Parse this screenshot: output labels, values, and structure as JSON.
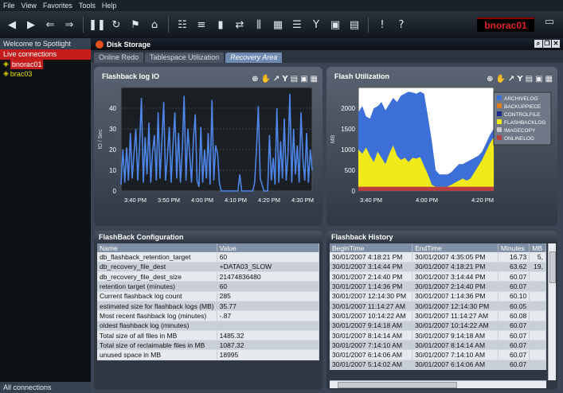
{
  "menu": [
    "File",
    "View",
    "Favorites",
    "Tools",
    "Help"
  ],
  "toolbar": {
    "icons": [
      "back-icon",
      "forward-icon",
      "nav-back-icon",
      "nav-forward-icon",
      "pause-icon",
      "refresh-icon",
      "bookmark-icon",
      "home-icon",
      "sessions-icon",
      "sql-icon",
      "bar-chart-icon",
      "swap-icon",
      "columns-icon",
      "grid-icon",
      "list-icon",
      "filter-icon",
      "export-icon",
      "report-icon",
      "alert-icon",
      "help-icon"
    ],
    "brand": "bnorac01"
  },
  "sidebar": {
    "header": "Welcome to Spotlight",
    "live_label": "Live connections",
    "items": [
      {
        "label": "bnorac01",
        "selected": true
      },
      {
        "label": "brac03",
        "selected": false
      }
    ],
    "footer": "All connections"
  },
  "window": {
    "title": "Disk Storage",
    "tabs": [
      "Online Redo",
      "Tablespace Utilization",
      "Recovery Area"
    ],
    "active_tab": 2
  },
  "charts": [
    {
      "title": "Flashback log IO",
      "chart_data": {
        "type": "line",
        "ylabel": "IO / Sec",
        "ylim": [
          0,
          50
        ],
        "yticks": [
          0,
          10,
          20,
          30,
          40
        ],
        "x_tick_labels": [
          "3:40 PM",
          "3:50 PM",
          "4:00 PM",
          "4:10 PM",
          "4:20 PM",
          "4:30 PM"
        ],
        "series": [
          {
            "color": "#4d86e8",
            "values": [
              3,
              20,
              4,
              21,
              5,
              28,
              6,
              18,
              30,
              5,
              22,
              45,
              4,
              26,
              8,
              33,
              4,
              19,
              27,
              5,
              38,
              6,
              24,
              43,
              5,
              17,
              31,
              4,
              22,
              38,
              6,
              28,
              4,
              20,
              46,
              5,
              30,
              18,
              4,
              25,
              37,
              5,
              2,
              31,
              4,
              20,
              6,
              28,
              3,
              44,
              5,
              22,
              18,
              4,
              0,
              0,
              0,
              0,
              0,
              0,
              0,
              0,
              0,
              0,
              8,
              0,
              0,
              0,
              0,
              0,
              0,
              0,
              4,
              20,
              41,
              6,
              3,
              0,
              0,
              0,
              27,
              5,
              16,
              3,
              40,
              4,
              24,
              6,
              35,
              5,
              18,
              47,
              4,
              30,
              8,
              22,
              4,
              38,
              16,
              5,
              28,
              4,
              20,
              10
            ]
          }
        ]
      }
    },
    {
      "title": "Flash Utilization",
      "chart_data": {
        "type": "area",
        "ylabel": "MB",
        "ylim": [
          0,
          2500
        ],
        "yticks": [
          0,
          500,
          1000,
          1500,
          2000
        ],
        "x_tick_labels": [
          "3:40 PM",
          "4:00 PM",
          "4:20 PM"
        ],
        "legend": [
          "ARCHIVELOG",
          "BACKUPPIECE",
          "CONTROLFILE",
          "FLASHBACKLOG",
          "IMAGECOPY",
          "ONLINELOG"
        ],
        "legend_colors": [
          "#3c6fd8",
          "#e07a1a",
          "#1c2a8a",
          "#f0ea1a",
          "#c8c8c8",
          "#b84040"
        ],
        "series": [
          {
            "name": "ONLINELOG",
            "color": "#b84040",
            "values": [
              100,
              100,
              100,
              100,
              100,
              100,
              100,
              100,
              100,
              100,
              100,
              100,
              100,
              100,
              100,
              100,
              100,
              100,
              100,
              100,
              100,
              100,
              100,
              100,
              100,
              100,
              100,
              100,
              100,
              100,
              100,
              100,
              100,
              100,
              100,
              100
            ]
          },
          {
            "name": "FLASHBACKLOG",
            "color": "#f0ea1a",
            "values": [
              1000,
              900,
              1050,
              850,
              700,
              950,
              800,
              650,
              900,
              1100,
              850,
              750,
              800,
              700,
              800,
              780,
              820,
              600,
              400,
              150,
              100,
              100,
              100,
              100,
              150,
              200,
              250,
              300,
              250,
              300,
              450,
              600,
              750,
              950,
              1150,
              1300
            ]
          },
          {
            "name": "ARCHIVELOG",
            "color": "#3c6fd8",
            "values": [
              1900,
              2050,
              1800,
              1750,
              2000,
              2050,
              2150,
              1950,
              2100,
              2250,
              2150,
              2300,
              2350,
              2400,
              2380,
              2350,
              2400,
              2350,
              1800,
              1200,
              500,
              400,
              400,
              400,
              450,
              550,
              650,
              650,
              700,
              750,
              800,
              850,
              950,
              1150,
              1350,
              1500
            ]
          }
        ]
      }
    }
  ],
  "flashback_config": {
    "title": "FlashBack Configuration",
    "columns": [
      "Name",
      "Value"
    ],
    "rows": [
      [
        "db_flashback_retention_target",
        "60"
      ],
      [
        "db_recovery_file_dest",
        "+DATA03_SLOW"
      ],
      [
        "db_recovery_file_dest_size",
        "21474836480"
      ],
      [
        "retention target (minutes)",
        "60"
      ],
      [
        "Current flashback log count",
        "285"
      ],
      [
        "estimated size for flashback logs (MB)",
        "35.77"
      ],
      [
        "Most recent flashback log (minutes)",
        "-.87"
      ],
      [
        "oldest flashback log (minutes)",
        ""
      ],
      [
        "Total size of all files in MB",
        "1485.32"
      ],
      [
        "Total size of reclaimable files in MB",
        "1087.32"
      ],
      [
        "unused space in MB",
        "18995"
      ]
    ]
  },
  "flashback_history": {
    "title": "Flashback History",
    "columns": [
      "BeginTime",
      "EndTime",
      "Minutes",
      "MB"
    ],
    "rows": [
      [
        "30/01/2007 4:18:21 PM",
        "30/01/2007 4:35:05 PM",
        "16.73",
        "5,"
      ],
      [
        "30/01/2007 3:14:44 PM",
        "30/01/2007 4:18:21 PM",
        "63.62",
        "19,"
      ],
      [
        "30/01/2007 2:14:40 PM",
        "30/01/2007 3:14:44 PM",
        "60.07",
        ""
      ],
      [
        "30/01/2007 1:14:36 PM",
        "30/01/2007 2:14:40 PM",
        "60.07",
        ""
      ],
      [
        "30/01/2007 12:14:30 PM",
        "30/01/2007 1:14:36 PM",
        "60.10",
        ""
      ],
      [
        "30/01/2007 11:14:27 AM",
        "30/01/2007 12:14:30 PM",
        "60.05",
        ""
      ],
      [
        "30/01/2007 10:14:22 AM",
        "30/01/2007 11:14:27 AM",
        "60.08",
        ""
      ],
      [
        "30/01/2007 9:14:18 AM",
        "30/01/2007 10:14:22 AM",
        "60.07",
        ""
      ],
      [
        "30/01/2007 8:14:14 AM",
        "30/01/2007 9:14:18 AM",
        "60.07",
        ""
      ],
      [
        "30/01/2007 7:14:10 AM",
        "30/01/2007 8:14:14 AM",
        "60.07",
        ""
      ],
      [
        "30/01/2007 6:14:06 AM",
        "30/01/2007 7:14:10 AM",
        "60.07",
        ""
      ],
      [
        "30/01/2007 5:14:02 AM",
        "30/01/2007 6:14:06 AM",
        "60.07",
        ""
      ]
    ]
  }
}
